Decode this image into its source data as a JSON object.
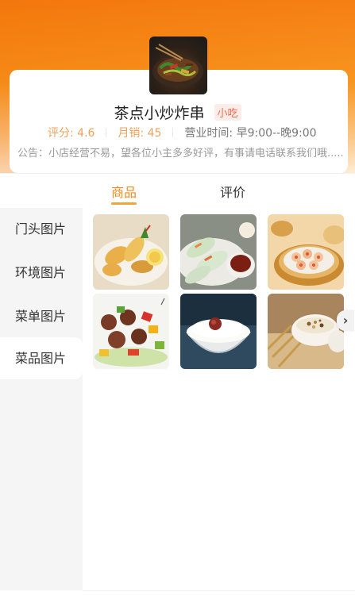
{
  "shop": {
    "name": "茶点小炒炸串",
    "tag": "小吃",
    "rating": "评分: 4.6",
    "monthly_sales": "月销: 45",
    "hours": "营业时间: 早9:00--晚9:00",
    "notice": "公告：小店经营不易，望各位小主多多好评，有事请电话联系我们哦....."
  },
  "tabs": [
    {
      "label": "商品",
      "active": true
    },
    {
      "label": "评价",
      "active": false
    }
  ],
  "categories": [
    {
      "label": "门头图片",
      "active": false
    },
    {
      "label": "环境图片",
      "active": false
    },
    {
      "label": "菜单图片",
      "active": false
    },
    {
      "label": "菜品图片",
      "active": true
    }
  ],
  "photos": [
    {
      "icon": "tempura-photo"
    },
    {
      "icon": "spring-rolls-photo"
    },
    {
      "icon": "shrimp-dumplings-photo"
    },
    {
      "icon": "meatball-skewers-photo"
    },
    {
      "icon": "rice-bowl-photo"
    },
    {
      "icon": "cereal-bowl-photo"
    }
  ],
  "colors": {
    "accent": "#f08a1c",
    "header_orange": "#f47a10",
    "tag_red": "#ef6a4a",
    "stat_orange": "#f2a15a"
  }
}
